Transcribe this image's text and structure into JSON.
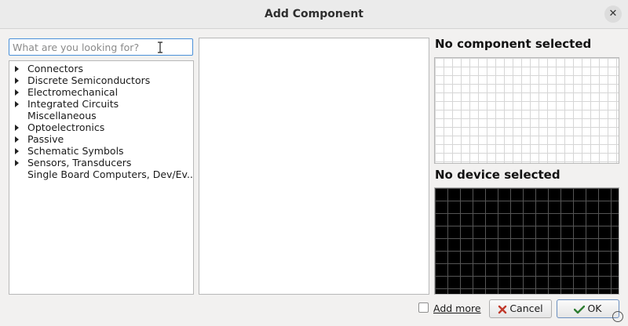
{
  "window": {
    "title": "Add Component",
    "close_icon": "close-icon"
  },
  "search": {
    "placeholder": "What are you looking for?",
    "value": ""
  },
  "library_tree": {
    "items": [
      {
        "label": "Connectors",
        "expandable": true
      },
      {
        "label": "Discrete Semiconductors",
        "expandable": true
      },
      {
        "label": "Electromechanical",
        "expandable": true
      },
      {
        "label": "Integrated Circuits",
        "expandable": true
      },
      {
        "label": "Miscellaneous",
        "expandable": false
      },
      {
        "label": "Optoelectronics",
        "expandable": true
      },
      {
        "label": "Passive",
        "expandable": true
      },
      {
        "label": "Schematic Symbols",
        "expandable": true
      },
      {
        "label": "Sensors, Transducers",
        "expandable": true
      },
      {
        "label": "Single Board Computers, Dev/Ev...",
        "expandable": false
      }
    ]
  },
  "preview": {
    "component_heading": "No component selected",
    "device_heading": "No device selected"
  },
  "footer": {
    "add_more_label": "Add more",
    "add_more_checked": false,
    "cancel_label": "Cancel",
    "ok_label": "OK"
  },
  "colors": {
    "accent_focus": "#4a90d9",
    "footprint_bg": "#000000",
    "symbol_bg": "#ffffff"
  }
}
